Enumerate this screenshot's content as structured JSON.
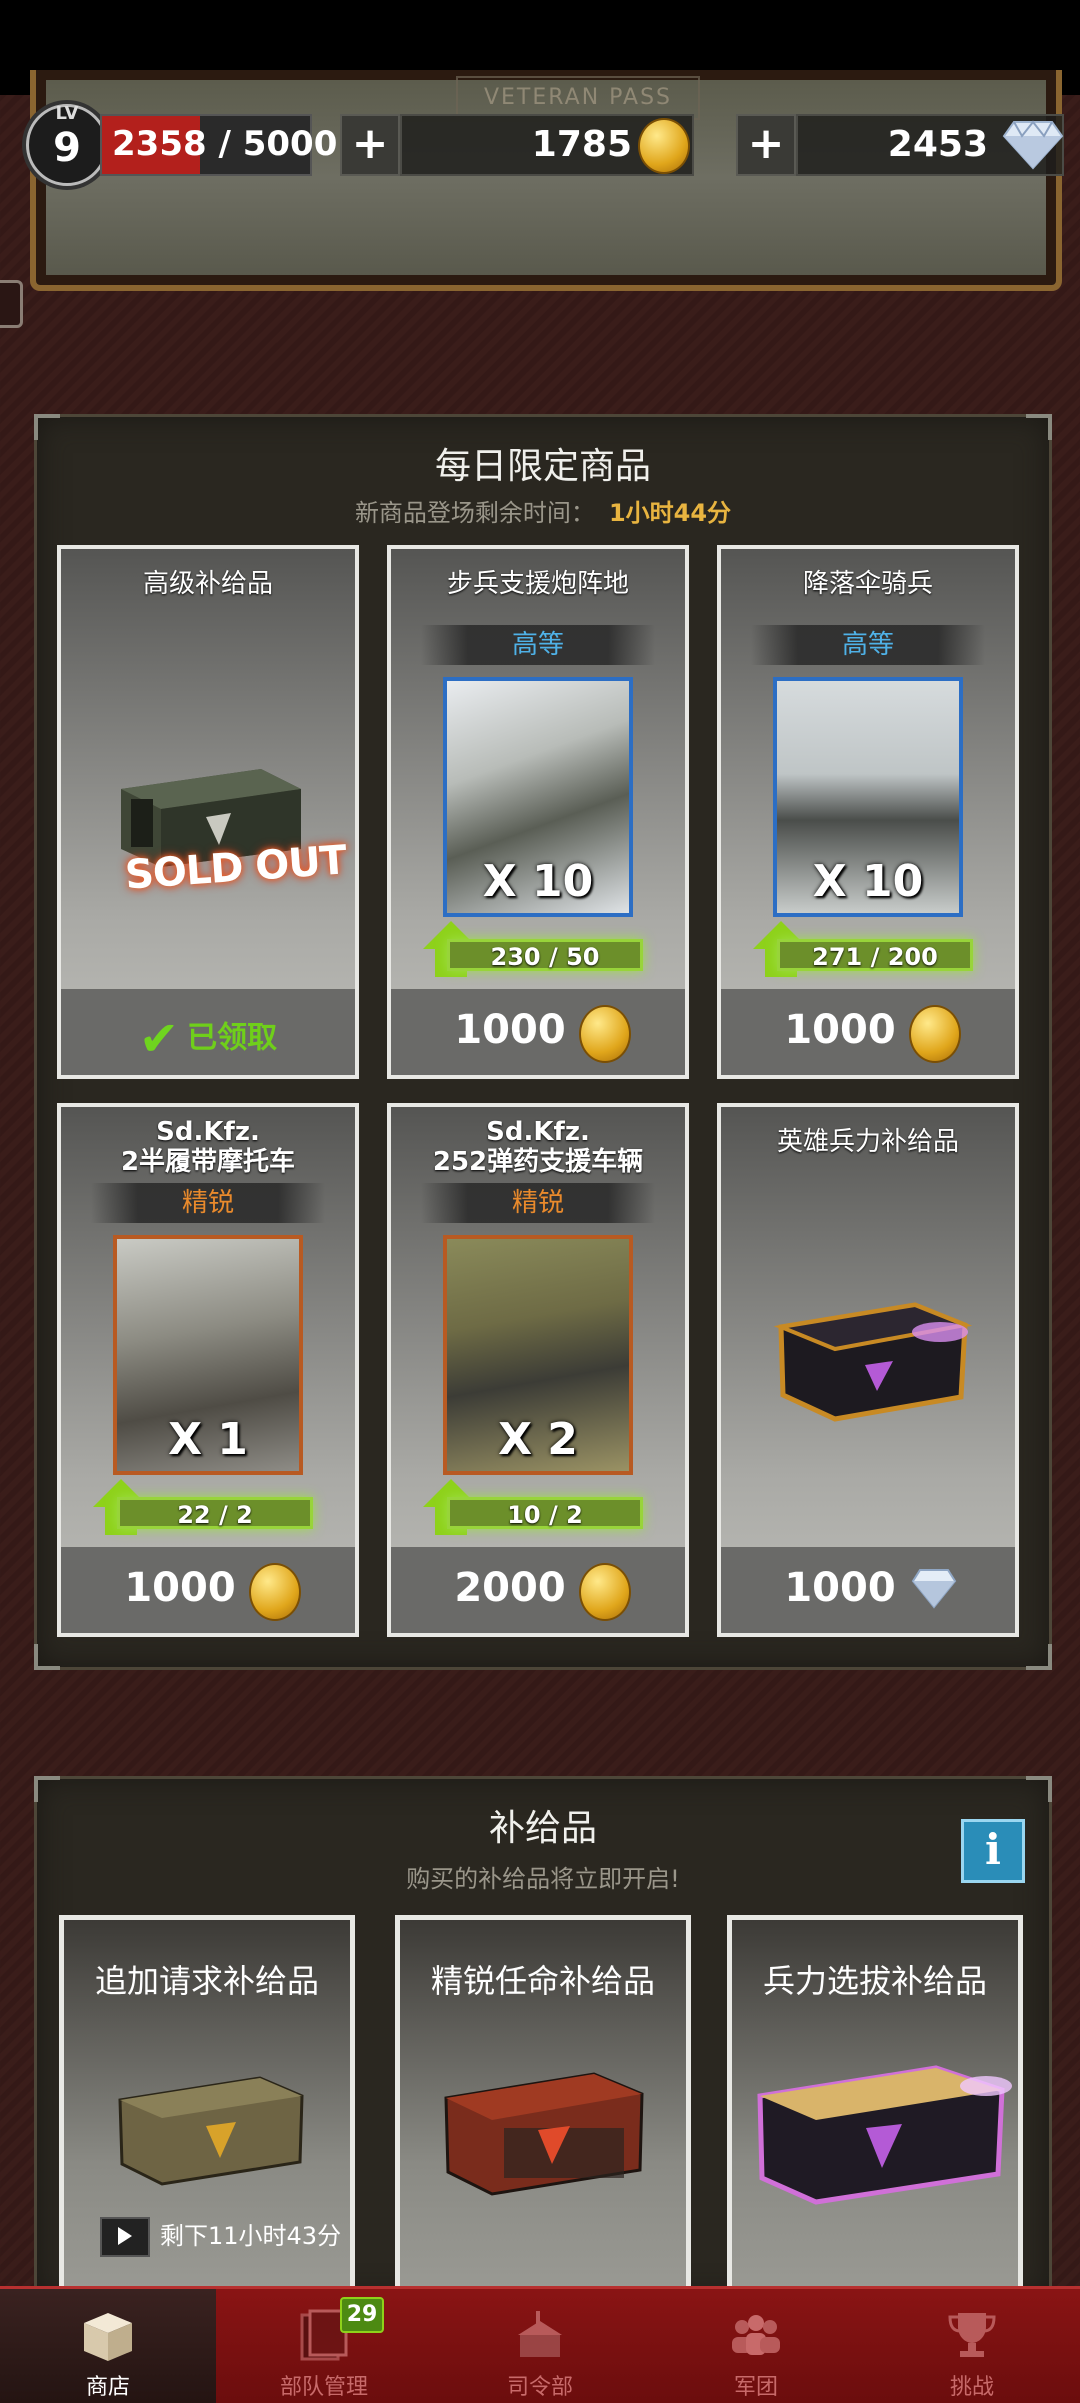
{
  "player": {
    "level_label": "LV",
    "level": "9",
    "xp_current": "2358",
    "xp_text": "/ 5000",
    "xp_progress": 0.47
  },
  "currency": {
    "plus": "+",
    "gold": "1785",
    "diamonds": "2453"
  },
  "banner": {
    "text": "VETERAN PASS"
  },
  "daily": {
    "title": "每日限定商品",
    "refresh_label": "新商品登场剩余时间：",
    "refresh_time": "1小时44分",
    "items": [
      {
        "name": "高级补给品",
        "sold_out": "SOLD OUT",
        "status": "已领取"
      },
      {
        "name": "步兵支援炮阵地",
        "rank": "高等",
        "qty": "X 10",
        "progress": "230 / 50",
        "price": "1000",
        "currency": "gold"
      },
      {
        "name": "降落伞骑兵",
        "rank": "高等",
        "qty": "X 10",
        "progress": "271 / 200",
        "price": "1000",
        "currency": "gold"
      },
      {
        "name_line1": "Sd.Kfz.",
        "name_line2": "2半履带摩托车",
        "rank": "精锐",
        "qty": "X 1",
        "progress": "22 / 2",
        "price": "1000",
        "currency": "gold"
      },
      {
        "name_line1": "Sd.Kfz.",
        "name_line2": "252弹药支援车辆",
        "rank": "精锐",
        "qty": "X 2",
        "progress": "10 / 2",
        "price": "2000",
        "currency": "gold"
      },
      {
        "name": "英雄兵力补给品",
        "price": "1000",
        "currency": "diamond"
      }
    ]
  },
  "supplies": {
    "title": "补给品",
    "subtitle": "购买的补给品将立即开启!",
    "info": "i",
    "items": [
      {
        "name": "追加请求补给品",
        "timer": "剩下11小时43分"
      },
      {
        "name": "精锐任命补给品"
      },
      {
        "name": "兵力选拔补给品"
      }
    ]
  },
  "nav": [
    {
      "label": "商店",
      "icon": "shop-box-icon",
      "active": true
    },
    {
      "label": "部队管理",
      "icon": "cards-icon",
      "badge": "29"
    },
    {
      "label": "司令部",
      "icon": "headquarters-icon"
    },
    {
      "label": "军团",
      "icon": "legion-icon"
    },
    {
      "label": "挑战",
      "icon": "trophy-icon"
    }
  ],
  "colors": {
    "accent_gold": "#e8b440",
    "rank_blue": "#4fb2e8",
    "rank_orange": "#e98a2c",
    "progress_green": "#8ed11a",
    "nav_red": "#8a1414"
  }
}
